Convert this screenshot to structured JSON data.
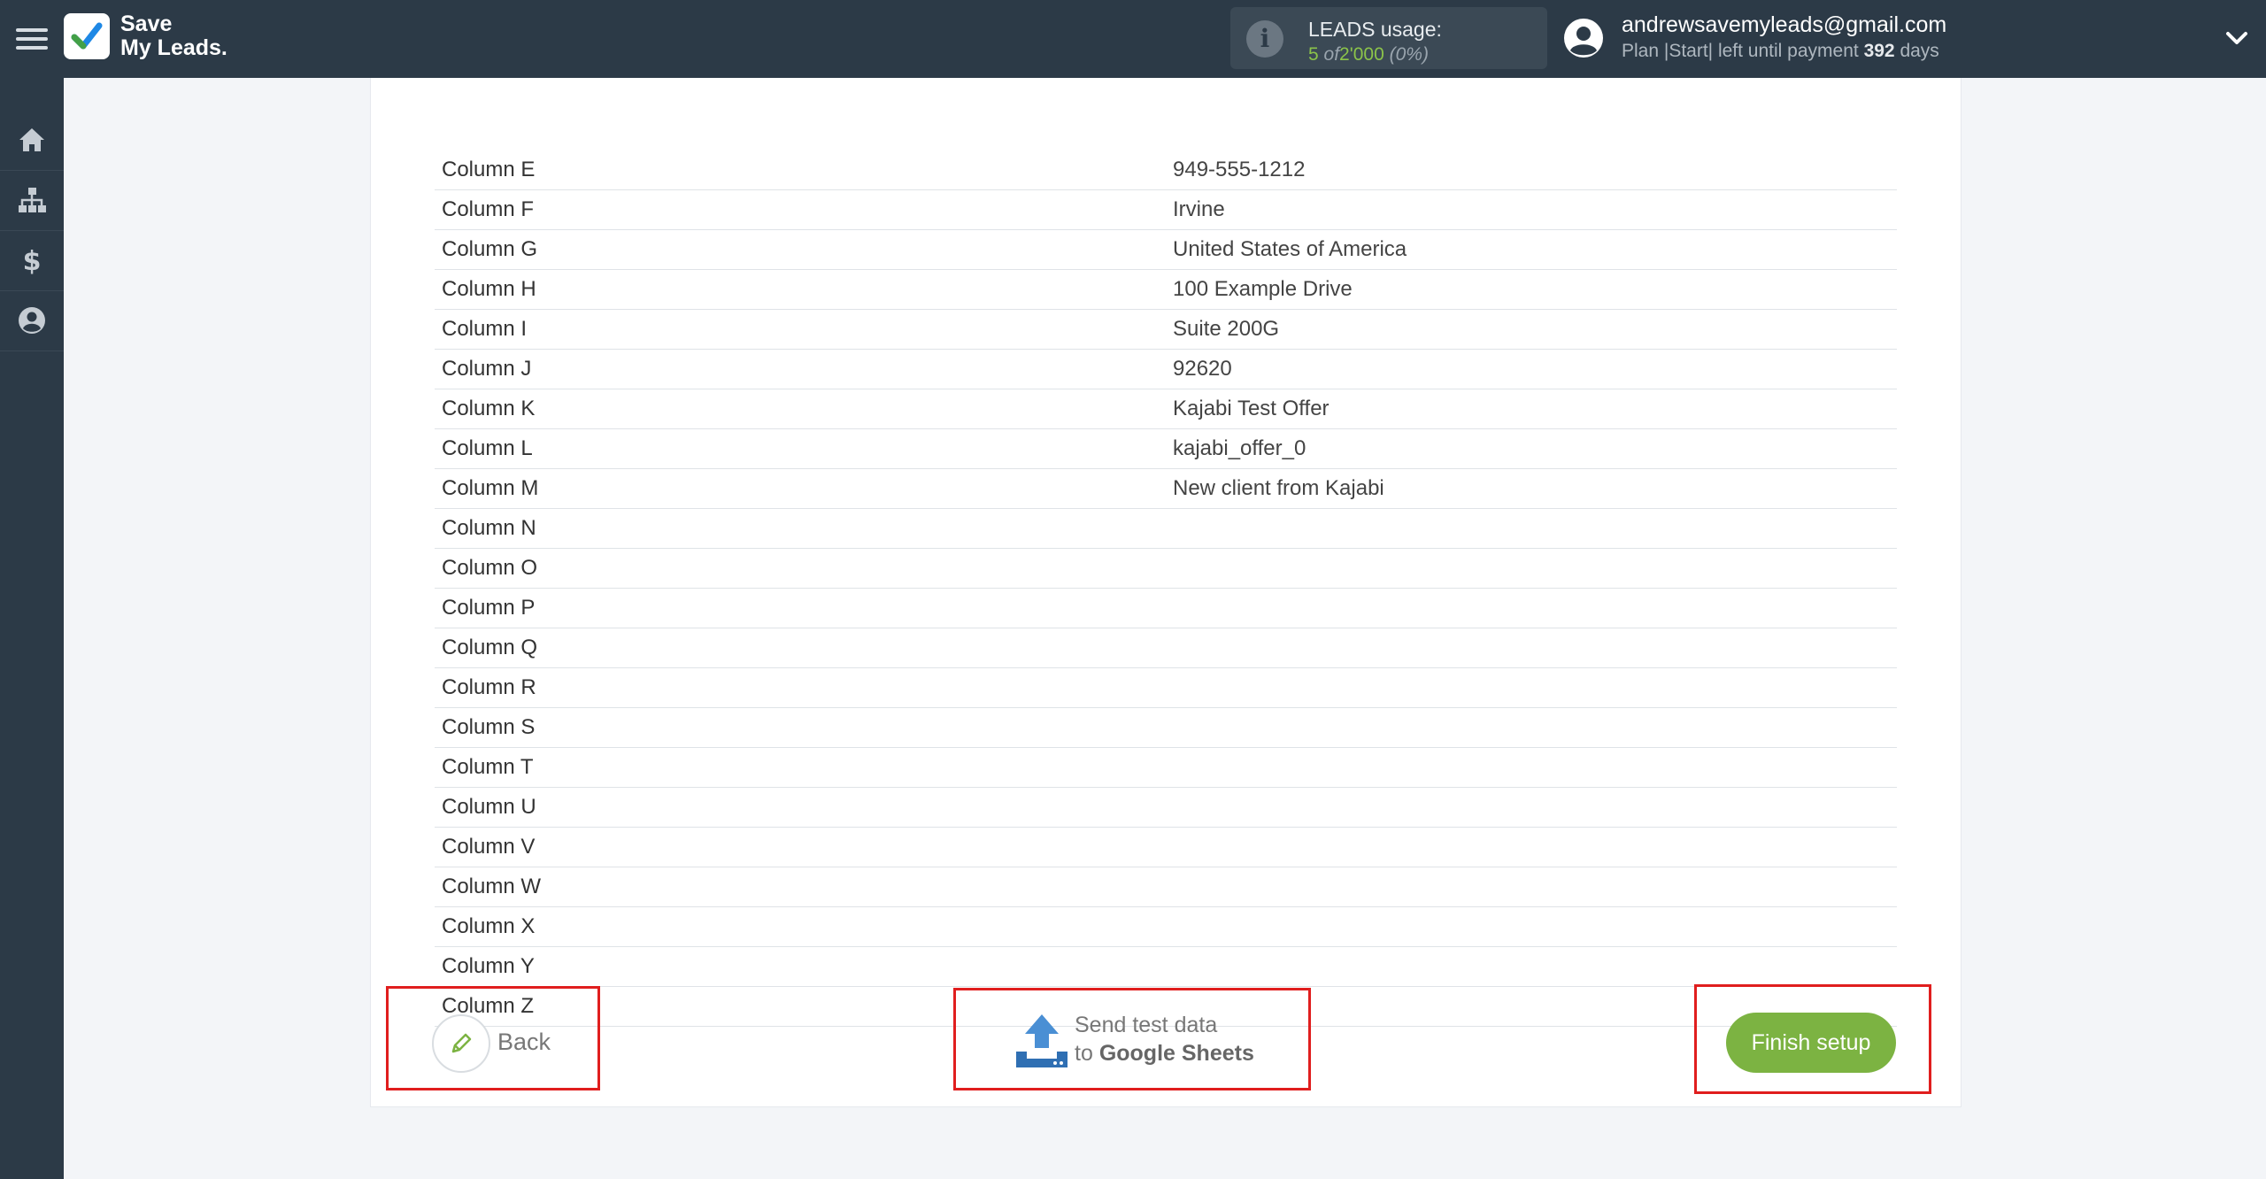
{
  "app": {
    "logo_line1": "Save",
    "logo_line2": "My Leads."
  },
  "header": {
    "leads_label": "LEADS usage:",
    "leads_used": "5",
    "leads_of": "of",
    "leads_total": "2'000",
    "leads_pct": "(0%)",
    "user_email": "andrewsavemyleads@gmail.com",
    "plan_text": "Plan |Start| left until payment",
    "plan_days": "392",
    "plan_days_suffix": "days"
  },
  "sidebar": {
    "items": [
      {
        "icon": "home-icon"
      },
      {
        "icon": "sitemap-icon"
      },
      {
        "icon": "dollar-icon"
      },
      {
        "icon": "user-circle-icon"
      }
    ]
  },
  "table": {
    "rows": [
      {
        "column": "Column E",
        "value": "949-555-1212"
      },
      {
        "column": "Column F",
        "value": "Irvine"
      },
      {
        "column": "Column G",
        "value": "United States of America"
      },
      {
        "column": "Column H",
        "value": "100 Example Drive"
      },
      {
        "column": "Column I",
        "value": "Suite 200G"
      },
      {
        "column": "Column J",
        "value": "92620"
      },
      {
        "column": "Column K",
        "value": "Kajabi Test Offer"
      },
      {
        "column": "Column L",
        "value": "kajabi_offer_0"
      },
      {
        "column": "Column M",
        "value": "New client from Kajabi"
      },
      {
        "column": "Column N",
        "value": ""
      },
      {
        "column": "Column O",
        "value": ""
      },
      {
        "column": "Column P",
        "value": ""
      },
      {
        "column": "Column Q",
        "value": ""
      },
      {
        "column": "Column R",
        "value": ""
      },
      {
        "column": "Column S",
        "value": ""
      },
      {
        "column": "Column T",
        "value": ""
      },
      {
        "column": "Column U",
        "value": ""
      },
      {
        "column": "Column V",
        "value": ""
      },
      {
        "column": "Column W",
        "value": ""
      },
      {
        "column": "Column X",
        "value": ""
      },
      {
        "column": "Column Y",
        "value": ""
      },
      {
        "column": "Column Z",
        "value": ""
      }
    ]
  },
  "actions": {
    "back_label": "Back",
    "send_line1": "Send test data",
    "send_line2_prefix": "to",
    "send_line2_target": "Google Sheets",
    "finish_label": "Finish setup"
  },
  "colors": {
    "topbar": "#2c3a47",
    "accent_green": "#7cb342",
    "highlight_red": "#e01e1e"
  }
}
